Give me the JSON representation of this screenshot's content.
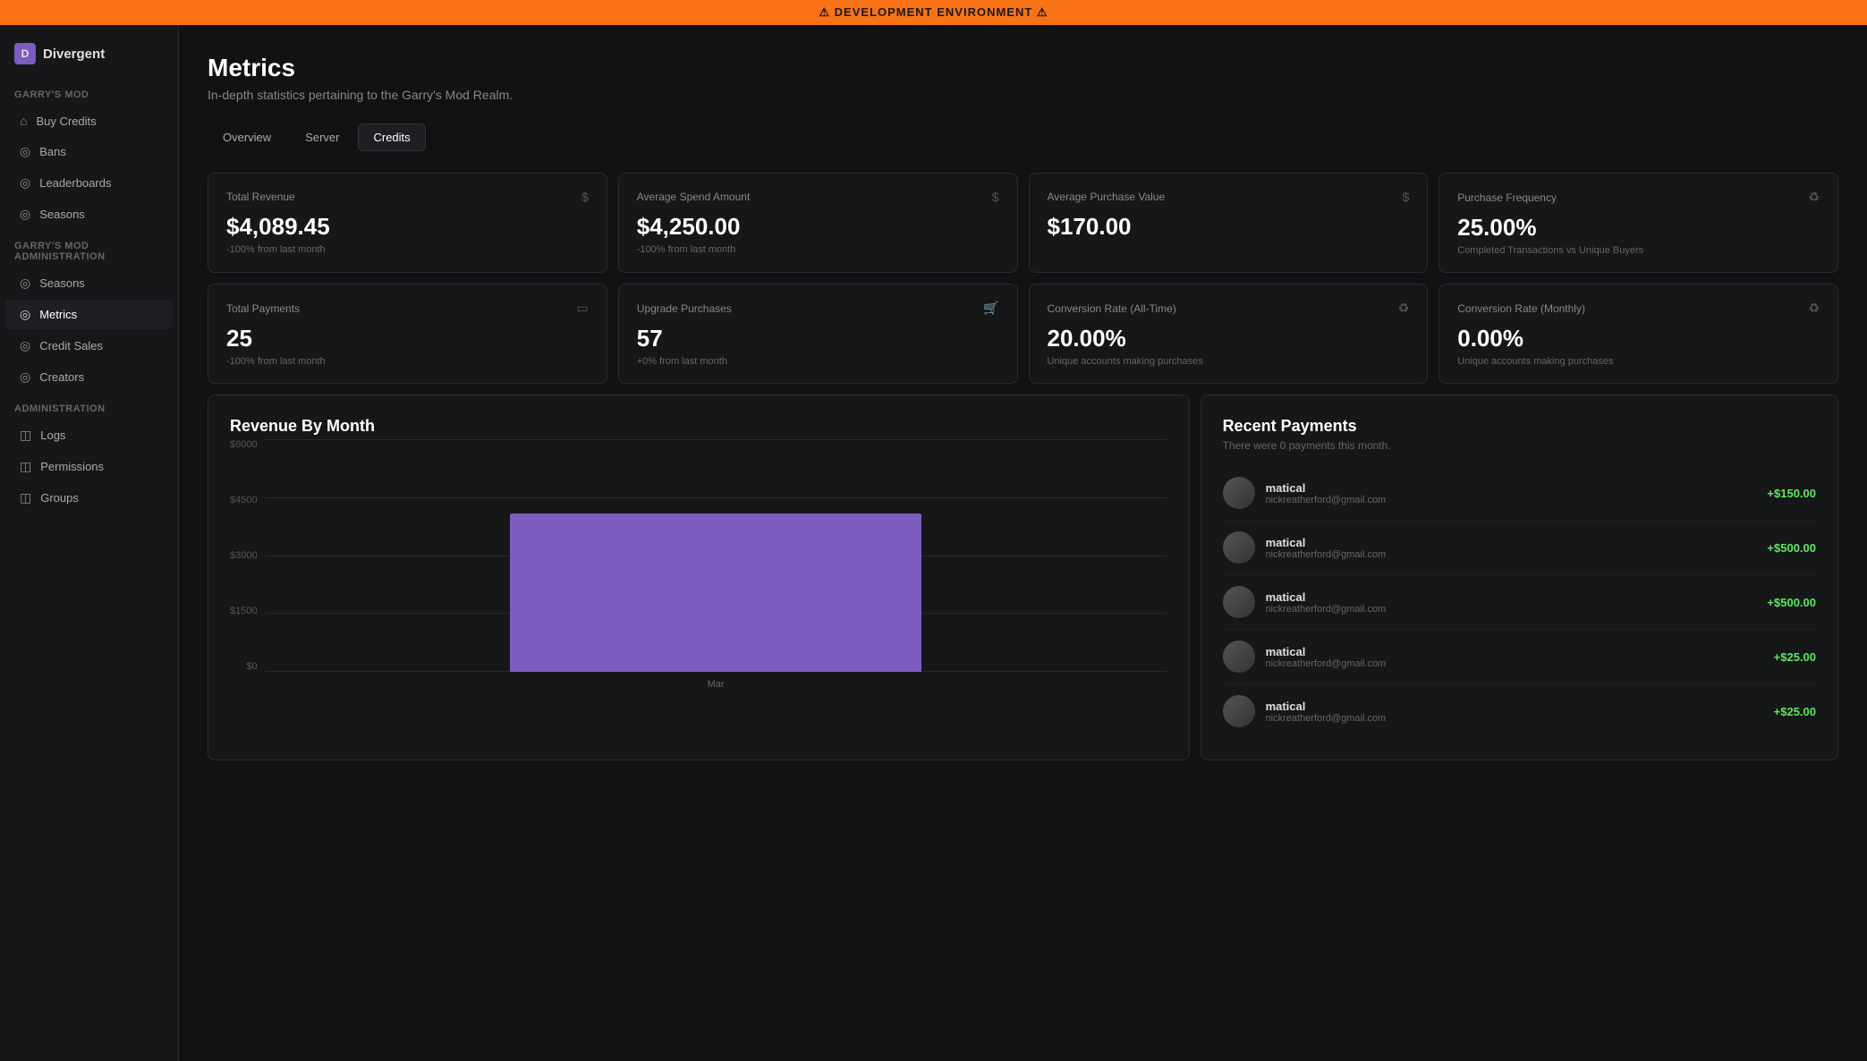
{
  "banner": {
    "text": "⚠ DEVELOPMENT ENVIRONMENT ⚠"
  },
  "sidebar": {
    "brand": "Divergent",
    "sections": [
      {
        "label": "Garry's Mod",
        "items": [
          {
            "id": "buy-credits",
            "label": "Buy Credits",
            "icon": "◎"
          },
          {
            "id": "bans",
            "label": "Bans",
            "icon": "◎"
          },
          {
            "id": "leaderboards",
            "label": "Leaderboards",
            "icon": "◎"
          },
          {
            "id": "seasons",
            "label": "Seasons",
            "icon": "◎"
          }
        ]
      },
      {
        "label": "Garry's Mod Administration",
        "items": [
          {
            "id": "gm-seasons",
            "label": "Seasons",
            "icon": "◎"
          },
          {
            "id": "metrics",
            "label": "Metrics",
            "icon": "◎",
            "active": true
          },
          {
            "id": "credit-sales",
            "label": "Credit Sales",
            "icon": "◎"
          },
          {
            "id": "creators",
            "label": "Creators",
            "icon": "◎"
          }
        ]
      },
      {
        "label": "Administration",
        "items": [
          {
            "id": "logs",
            "label": "Logs",
            "icon": "◫"
          },
          {
            "id": "permissions",
            "label": "Permissions",
            "icon": "◫"
          },
          {
            "id": "groups",
            "label": "Groups",
            "icon": "◫"
          }
        ]
      }
    ]
  },
  "page": {
    "title": "Metrics",
    "subtitle": "In-depth statistics pertaining to the Garry's Mod Realm."
  },
  "tabs": [
    {
      "id": "overview",
      "label": "Overview",
      "active": false
    },
    {
      "id": "server",
      "label": "Server",
      "active": false
    },
    {
      "id": "credits",
      "label": "Credits",
      "active": true
    }
  ],
  "stats_row1": [
    {
      "id": "total-revenue",
      "label": "Total Revenue",
      "icon": "$",
      "value": "$4,089.45",
      "change": "-100% from last month"
    },
    {
      "id": "avg-spend",
      "label": "Average Spend Amount",
      "icon": "$",
      "value": "$4,250.00",
      "change": "-100% from last month"
    },
    {
      "id": "avg-purchase",
      "label": "Average Purchase Value",
      "icon": "$",
      "value": "$170.00",
      "change": ""
    },
    {
      "id": "purchase-freq",
      "label": "Purchase Frequency",
      "icon": "⟳",
      "value": "25.00%",
      "note": "Completed Transactions vs Unique Buyers"
    }
  ],
  "stats_row2": [
    {
      "id": "total-payments",
      "label": "Total Payments",
      "icon": "▭",
      "value": "25",
      "change": "-100% from last month"
    },
    {
      "id": "upgrade-purchases",
      "label": "Upgrade Purchases",
      "icon": "🛒",
      "value": "57",
      "change": "+0% from last month"
    },
    {
      "id": "conversion-alltime",
      "label": "Conversion Rate (All-Time)",
      "icon": "⟳",
      "value": "20.00%",
      "note": "Unique accounts making purchases"
    },
    {
      "id": "conversion-monthly",
      "label": "Conversion Rate (Monthly)",
      "icon": "⟳",
      "value": "0.00%",
      "note": "Unique accounts making purchases"
    }
  ],
  "chart": {
    "title": "Revenue By Month",
    "y_labels": [
      "$6000",
      "$4500",
      "$3000",
      "$1500",
      "$0"
    ],
    "bars": [
      {
        "month": "Mar",
        "value": 4089,
        "height_pct": 68
      }
    ],
    "x_label": "Mar"
  },
  "recent_payments": {
    "title": "Recent Payments",
    "subtitle": "There were 0 payments this month.",
    "items": [
      {
        "name": "matical",
        "email": "nickreatherford@gmail.com",
        "amount": "+$150.00"
      },
      {
        "name": "matical",
        "email": "nickreatherford@gmail.com",
        "amount": "+$500.00"
      },
      {
        "name": "matical",
        "email": "nickreatherford@gmail.com",
        "amount": "+$500.00"
      },
      {
        "name": "matical",
        "email": "nickreatherford@gmail.com",
        "amount": "+$25.00"
      },
      {
        "name": "matical",
        "email": "nickreatherford@gmail.com",
        "amount": "+$25.00"
      }
    ]
  }
}
